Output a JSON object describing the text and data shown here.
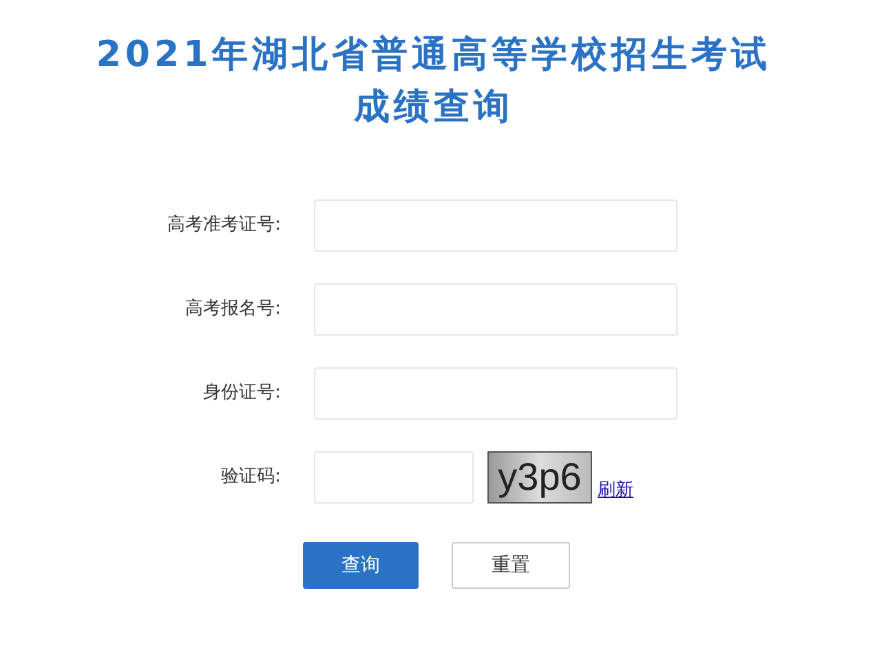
{
  "title": {
    "line_1": "2021年湖北省普通高等学校招生考试",
    "line_2": "成绩查询"
  },
  "fields": [
    {
      "kind": "text",
      "label": "高考准考证号:"
    },
    {
      "kind": "text",
      "label": "高考报名号:"
    },
    {
      "kind": "text",
      "label": "身份证号:"
    },
    {
      "kind": "captcha",
      "label": "验证码:",
      "captcha": "y3p6",
      "refresh": "刷新"
    }
  ],
  "buttons": [
    {
      "kind": "primary",
      "label": "查询"
    },
    {
      "kind": "secondary",
      "label": "重置"
    }
  ]
}
